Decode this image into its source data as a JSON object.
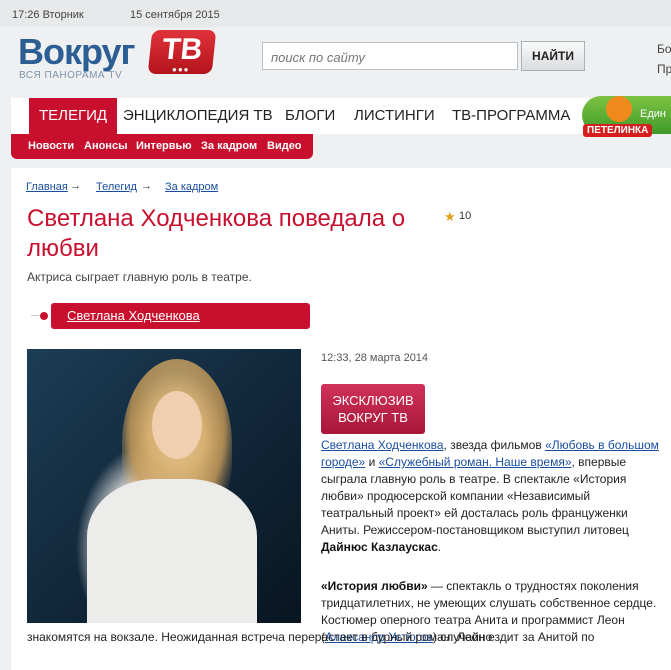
{
  "topbar": {
    "time_day": "17:26 Вторник",
    "date": "15 сентября 2015"
  },
  "header": {
    "logo_word": "Вокруг",
    "logo_tv": "ТВ",
    "logo_subtitle": "ВСЯ ПАНОРАМА TV",
    "search_placeholder": "поиск по сайту",
    "search_button": "НАЙТИ",
    "right_line1": "Бо",
    "right_line2": "Пр"
  },
  "nav": {
    "items": [
      "ТЕЛЕГИД",
      "ЭНЦИКЛОПЕДИЯ ТВ",
      "БЛОГИ",
      "ЛИСТИНГИ",
      "ТВ-ПРОГРАММА"
    ],
    "subitems": [
      "Новости",
      "Анонсы",
      "Интервью",
      "За кадром",
      "Видео"
    ],
    "promo_label": "ПЕТЕЛИНКА",
    "promo_text": "Един"
  },
  "breadcrumb": [
    "Главная",
    "Телегид",
    "За кадром"
  ],
  "article": {
    "title": "Светлана Ходченкова поведала о любви",
    "rating": "10",
    "lead": "Актриса сыграет главную роль в театре.",
    "tag": "Светлана Ходченкова",
    "date": "12:33, 28 марта 2014",
    "exclusive_line1": "ЭКСКЛЮЗИВ",
    "exclusive_line2": "ВОКРУГ ТВ",
    "p1": {
      "link1": "Светлана Ходченкова",
      "t1": ", звезда фильмов  ",
      "link2": "«Любовь в большом городе»",
      "t2": "  и  ",
      "link3": "«Служебный роман. Наше время»",
      "t3": ", впервые сыграла главную роль  в театре. В спектакле «История любви» продюсерской компании «Независимый театральный проект» ей досталась роль француженки Аниты. Режиссером-постановщиком выступил литовец ",
      "bold": "Дайнюс Казлаускас",
      "t4": "."
    },
    "p2": {
      "bold": "«История любви»",
      "t1": " — спектакль о трудностях поколения тридцатилетних, не умеющих слушать собственное сердце. Костюмер оперного театра Анита и программист Леон (",
      "link": "Александр Устюгов",
      "t2": ") случайно",
      "line2": "знакомятся на вокзале. Неожиданная встреча перерастает в бурный роман. Леон ездит за Анитой по"
    }
  },
  "colors": {
    "brand_red": "#c8102e",
    "brand_blue": "#2c5e94",
    "link": "#1a4fa0"
  }
}
